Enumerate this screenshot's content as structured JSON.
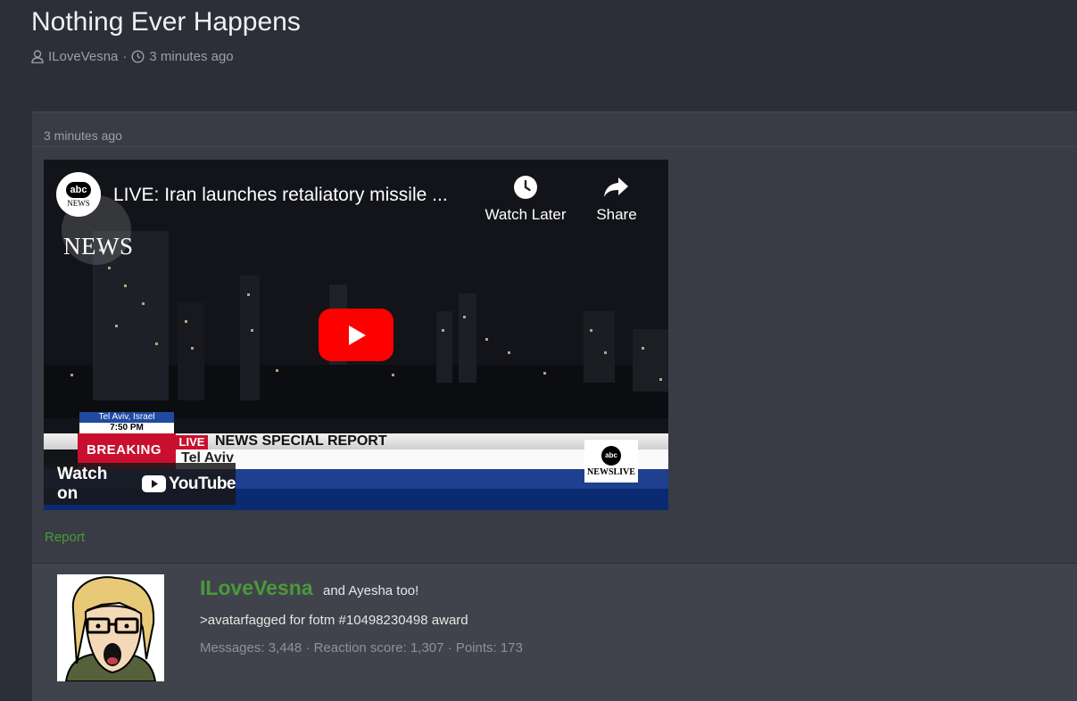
{
  "thread": {
    "title": "Nothing Ever Happens",
    "author": "ILoveVesna",
    "separator": "·",
    "time": "3 minutes ago"
  },
  "post": {
    "date": "3 minutes ago",
    "report_label": "Report"
  },
  "video": {
    "title": "LIVE: Iran launches retaliatory missile ...",
    "channel_logo_text": "abc",
    "channel_logo_sub": "NEWS",
    "overlay_news_text": "NEWS",
    "watch_later_label": "Watch Later",
    "share_label": "Share",
    "watch_on_label": "Watch on",
    "youtube_label": "YouTube",
    "lower_third": {
      "location": "Tel Aviv, Israel",
      "time": "7:50 PM",
      "breaking": "BREAKING",
      "live": "LIVE",
      "special": "NEWS SPECIAL REPORT",
      "sub": "Tel Aviv",
      "badge_abc": "abc",
      "badge_text": "NEWSLIVE"
    },
    "colors": {
      "play": "#ff0000",
      "breaking": "#c8102e",
      "band_blue": "#1f3f8f"
    }
  },
  "author": {
    "name": "ILoveVesna",
    "title": "and Ayesha too!",
    "signature": ">avatarfagged for fotm #10498230498 award",
    "stats": "Messages: 3,448 · Reaction score: 1,307 · Points: 173"
  },
  "icons": [
    "user-icon",
    "clock-icon",
    "watch-later-icon",
    "share-icon",
    "play-icon",
    "youtube-icon"
  ],
  "colors": {
    "accent_green": "#4a9a3a",
    "page_bg": "#2c2f37",
    "post_bg": "#393c44"
  }
}
